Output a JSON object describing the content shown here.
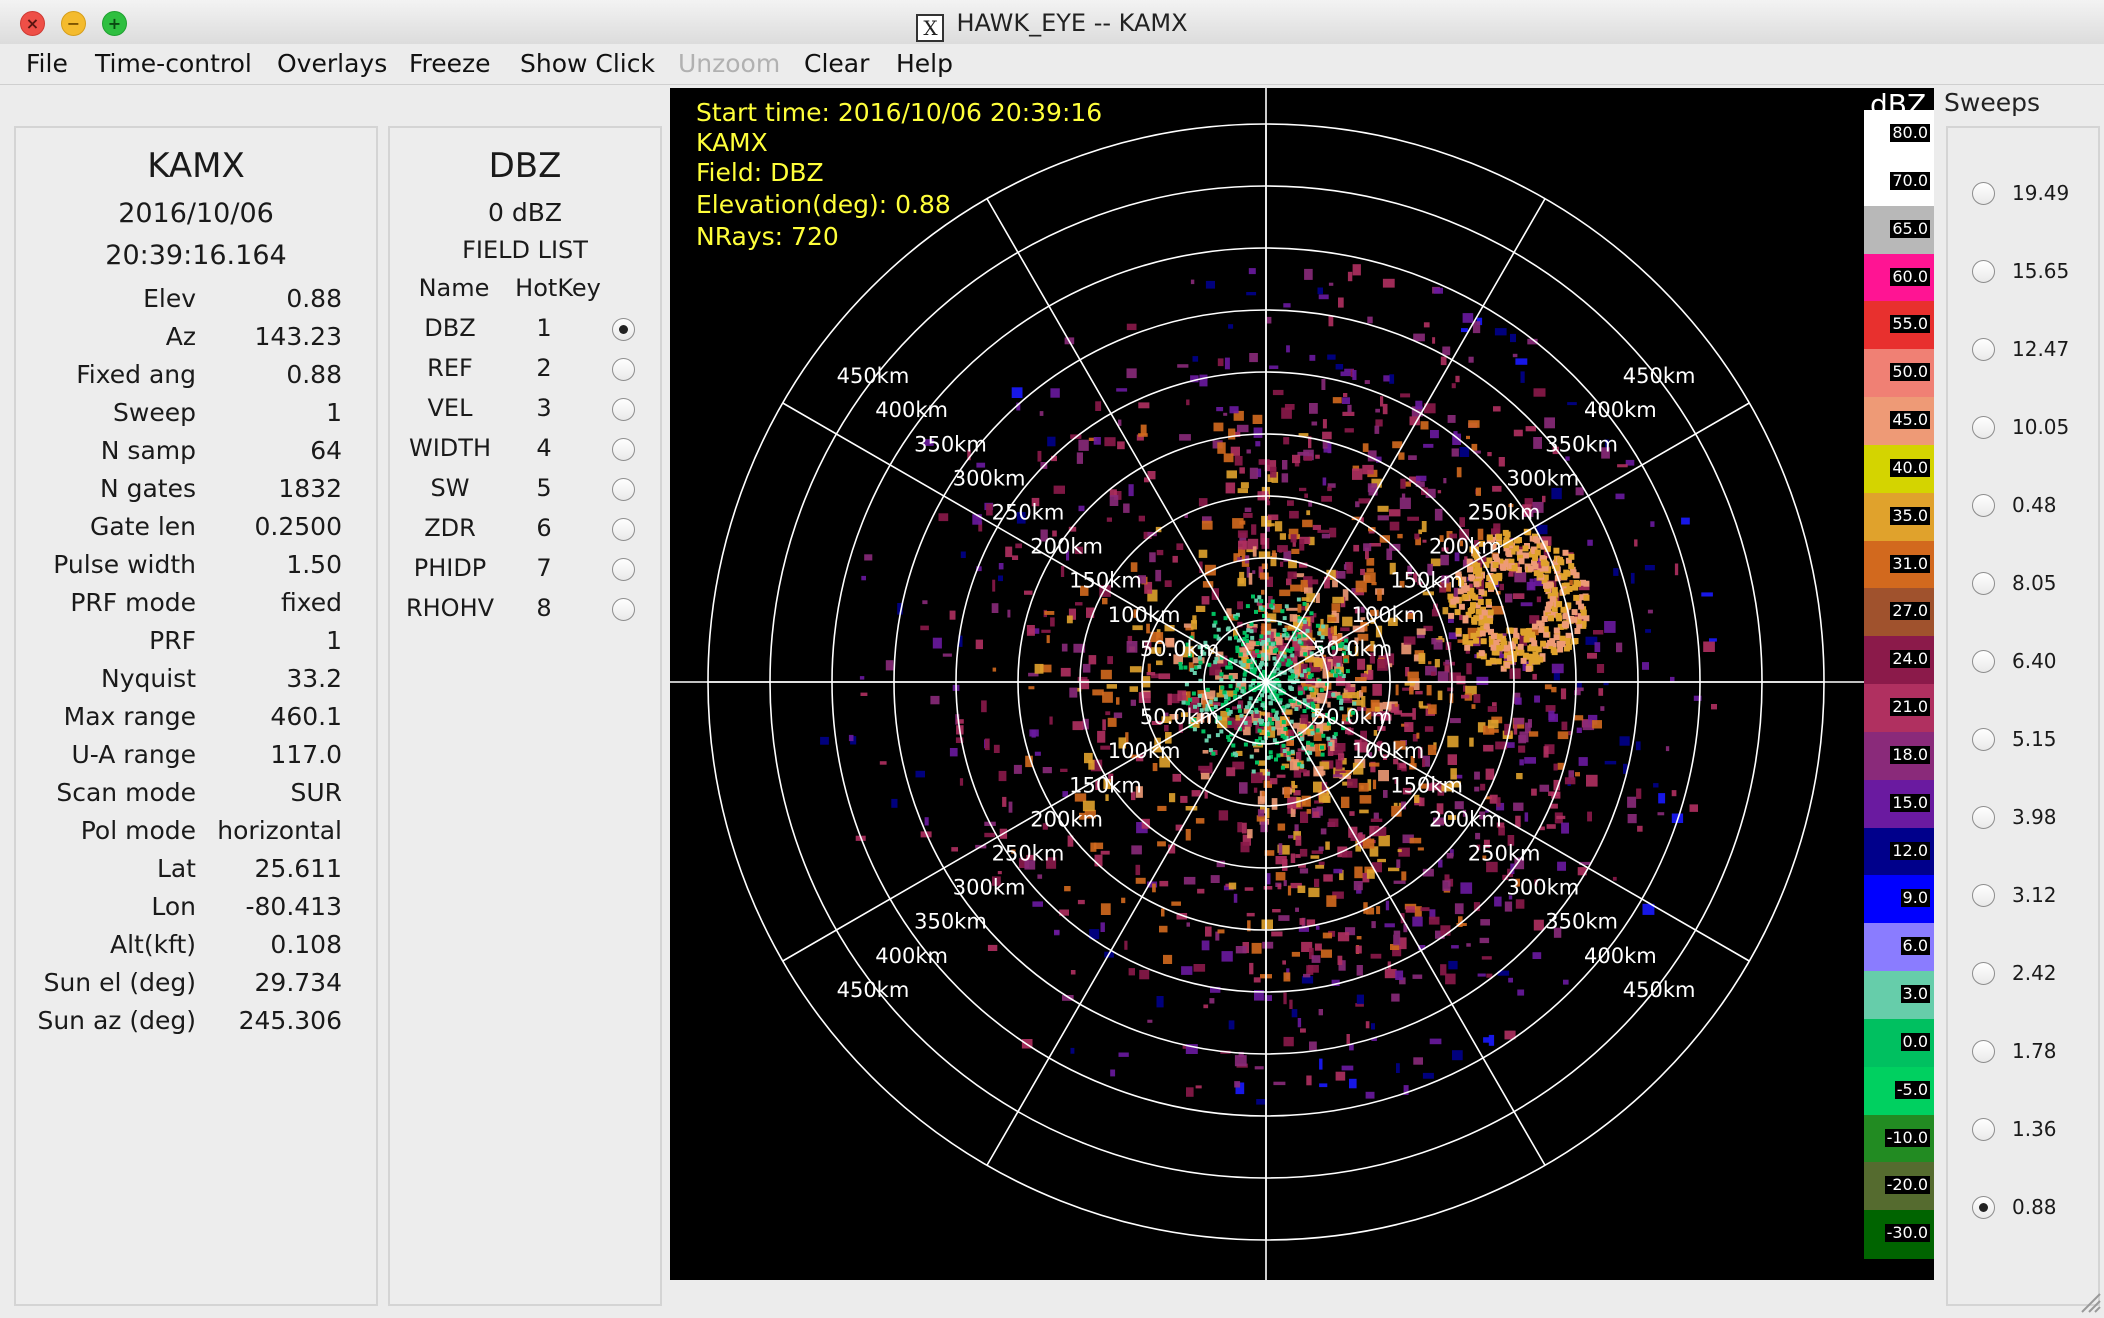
{
  "window": {
    "title": "HAWK_EYE -- KAMX"
  },
  "menu": [
    "File",
    "Time-control",
    "Overlays",
    "Freeze",
    "Show Click",
    "Unzoom",
    "Clear",
    "Help"
  ],
  "status": {
    "station": "KAMX",
    "date": "2016/10/06",
    "time": "20:39:16.164",
    "rows": [
      {
        "label": "Elev",
        "value": "0.88"
      },
      {
        "label": "Az",
        "value": "143.23"
      },
      {
        "label": "Fixed ang",
        "value": "0.88"
      },
      {
        "label": "Sweep",
        "value": "1"
      },
      {
        "label": "N samp",
        "value": "64"
      },
      {
        "label": "N gates",
        "value": "1832"
      },
      {
        "label": "Gate len",
        "value": "0.2500"
      },
      {
        "label": "Pulse width",
        "value": "1.50"
      },
      {
        "label": "PRF mode",
        "value": "fixed"
      },
      {
        "label": "PRF",
        "value": "1"
      },
      {
        "label": "Nyquist",
        "value": "33.2"
      },
      {
        "label": "Max range",
        "value": "460.1"
      },
      {
        "label": "U-A range",
        "value": "117.0"
      },
      {
        "label": "Scan mode",
        "value": "SUR"
      },
      {
        "label": "Pol mode",
        "value": "horizontal"
      },
      {
        "label": "Lat",
        "value": "25.611"
      },
      {
        "label": "Lon",
        "value": "-80.413"
      },
      {
        "label": "Alt(kft)",
        "value": "0.108"
      },
      {
        "label": "Sun el (deg)",
        "value": "29.734"
      },
      {
        "label": "Sun az (deg)",
        "value": "245.306"
      }
    ]
  },
  "fields": {
    "title": "DBZ",
    "value": "0 dBZ",
    "list_label": "FIELD LIST",
    "col_name": "Name",
    "col_hotkey": "HotKey",
    "items": [
      {
        "name": "DBZ",
        "key": "1",
        "selected": true
      },
      {
        "name": "REF",
        "key": "2",
        "selected": false
      },
      {
        "name": "VEL",
        "key": "3",
        "selected": false
      },
      {
        "name": "WIDTH",
        "key": "4",
        "selected": false
      },
      {
        "name": "SW",
        "key": "5",
        "selected": false
      },
      {
        "name": "ZDR",
        "key": "6",
        "selected": false
      },
      {
        "name": "PHIDP",
        "key": "7",
        "selected": false
      },
      {
        "name": "RHOHV",
        "key": "8",
        "selected": false
      }
    ]
  },
  "overlay": {
    "start_time": "Start time: 2016/10/06 20:39:16",
    "station": "KAMX",
    "field": "Field: DBZ",
    "elevation": "Elevation(deg): 0.88",
    "nrays": "NRays: 720"
  },
  "range_ring_labels": [
    "50.0km",
    "100km",
    "150km",
    "200km",
    "250km",
    "300km",
    "350km",
    "400km",
    "450km"
  ],
  "color_scale": {
    "unit": "dBZ",
    "entries": [
      {
        "value": "80.0",
        "color": "#ffffff"
      },
      {
        "value": "70.0",
        "color": "#ffffff"
      },
      {
        "value": "65.0",
        "color": "#b8b8b8"
      },
      {
        "value": "60.0",
        "color": "#ff1493"
      },
      {
        "value": "55.0",
        "color": "#e8302e"
      },
      {
        "value": "50.0",
        "color": "#f08074"
      },
      {
        "value": "45.0",
        "color": "#ee9a76"
      },
      {
        "value": "40.0",
        "color": "#d4d400"
      },
      {
        "value": "35.0",
        "color": "#e0a22c"
      },
      {
        "value": "31.0",
        "color": "#d2691e"
      },
      {
        "value": "27.0",
        "color": "#a0522d"
      },
      {
        "value": "24.0",
        "color": "#8b1a4a"
      },
      {
        "value": "21.0",
        "color": "#b03060"
      },
      {
        "value": "18.0",
        "color": "#8a2a7a"
      },
      {
        "value": "15.0",
        "color": "#6a1aa0"
      },
      {
        "value": "12.0",
        "color": "#00008b"
      },
      {
        "value": "9.0",
        "color": "#0000ff"
      },
      {
        "value": "6.0",
        "color": "#8a7cff"
      },
      {
        "value": "3.0",
        "color": "#66cdaa"
      },
      {
        "value": "0.0",
        "color": "#00c060"
      },
      {
        "value": "-5.0",
        "color": "#00d060"
      },
      {
        "value": "-10.0",
        "color": "#228b22"
      },
      {
        "value": "-20.0",
        "color": "#556b2f"
      },
      {
        "value": "-30.0",
        "color": "#006400"
      }
    ]
  },
  "sweeps": {
    "title": "Sweeps",
    "items": [
      {
        "label": "19.49",
        "selected": false
      },
      {
        "label": "15.65",
        "selected": false
      },
      {
        "label": "12.47",
        "selected": false
      },
      {
        "label": "10.05",
        "selected": false
      },
      {
        "label": "0.48",
        "selected": false
      },
      {
        "label": "8.05",
        "selected": false
      },
      {
        "label": "6.40",
        "selected": false
      },
      {
        "label": "5.15",
        "selected": false
      },
      {
        "label": "3.98",
        "selected": false
      },
      {
        "label": "3.12",
        "selected": false
      },
      {
        "label": "2.42",
        "selected": false
      },
      {
        "label": "1.78",
        "selected": false
      },
      {
        "label": "1.36",
        "selected": false
      },
      {
        "label": "0.88",
        "selected": true
      }
    ]
  }
}
